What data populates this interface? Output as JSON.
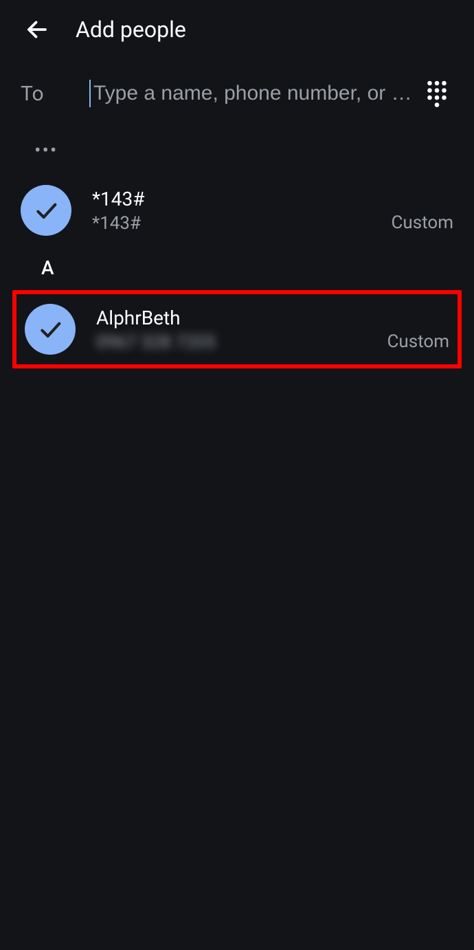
{
  "header": {
    "title": "Add people"
  },
  "search": {
    "to_label": "To",
    "placeholder": "Type a name, phone number, or …",
    "value": ""
  },
  "more_indicator": "•••",
  "sections": [
    {
      "letter": null,
      "contacts": [
        {
          "name": "*143#",
          "phone": "*143#",
          "label": "Custom",
          "selected": true,
          "highlighted": false,
          "phone_blurred": false
        }
      ]
    },
    {
      "letter": "A",
      "contacts": [
        {
          "name": "AlphrBeth",
          "phone": "0967 328 7205",
          "label": "Custom",
          "selected": true,
          "highlighted": true,
          "phone_blurred": true
        }
      ]
    }
  ]
}
